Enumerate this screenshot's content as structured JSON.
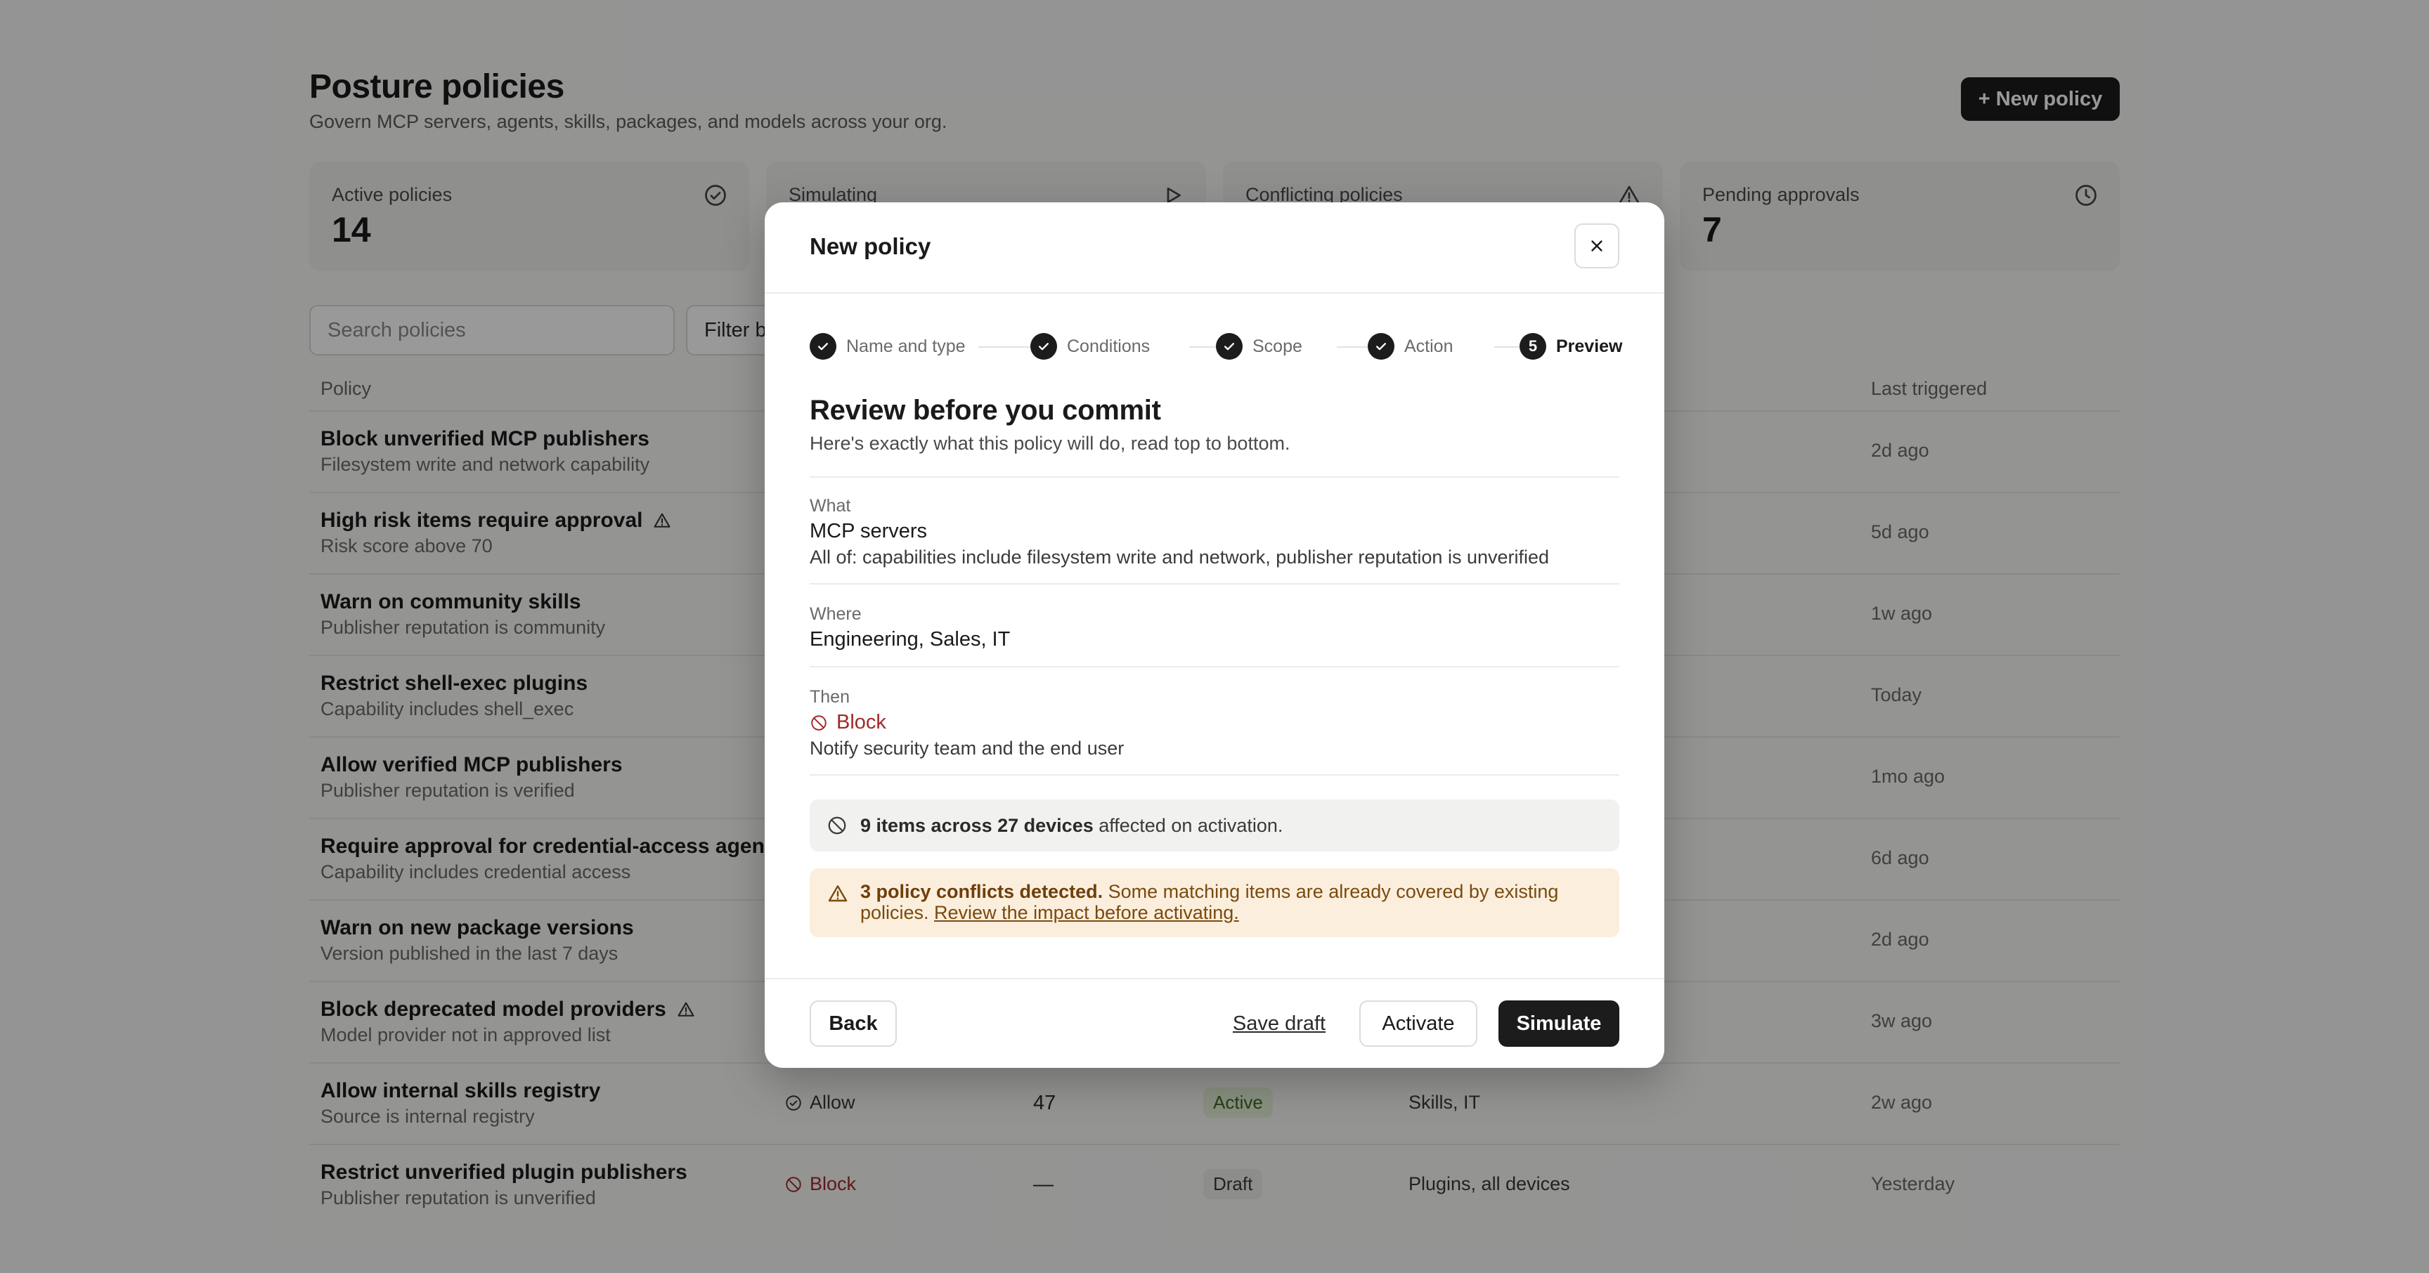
{
  "page": {
    "title": "Posture policies",
    "subtitle": "Govern MCP servers, agents, skills, packages, and models across your org.",
    "new_policy_label": "+ New policy"
  },
  "stats": [
    {
      "label": "Active policies",
      "value": "14",
      "icon": "check-circle-icon"
    },
    {
      "label": "Simulating",
      "value": "",
      "icon": "play-icon"
    },
    {
      "label": "Conflicting policies",
      "value": "",
      "icon": "warning-icon"
    },
    {
      "label": "Pending approvals",
      "value": "7",
      "icon": "clock-icon"
    }
  ],
  "toolbar": {
    "search_placeholder": "Search policies",
    "filter_label": "Filter b"
  },
  "table": {
    "columns": {
      "policy": "Policy",
      "last_triggered": "Last triggered"
    },
    "rows": [
      {
        "name": "Block unverified MCP publishers",
        "desc": "Filesystem write and network capability",
        "last": "2d ago"
      },
      {
        "name": "High risk items require approval",
        "desc": "Risk score above 70",
        "last": "5d ago",
        "warning": true
      },
      {
        "name": "Warn on community skills",
        "desc": "Publisher reputation is community",
        "last": "1w ago"
      },
      {
        "name": "Restrict shell-exec plugins",
        "desc": "Capability includes shell_exec",
        "last": "Today"
      },
      {
        "name": "Allow verified MCP publishers",
        "desc": "Publisher reputation is verified",
        "last": "1mo ago"
      },
      {
        "name": "Require approval for credential-access agents",
        "desc": "Capability includes credential access",
        "last": "6d ago"
      },
      {
        "name": "Warn on new package versions",
        "desc": "Version published in the last 7 days",
        "last": "2d ago"
      },
      {
        "name": "Block deprecated model providers",
        "desc": "Model provider not in approved list",
        "last": "3w ago",
        "warning": true
      },
      {
        "name": "Allow internal skills registry",
        "desc": "Source is internal registry",
        "last": "2w ago",
        "action": "Allow",
        "hits": "47",
        "status": "Active",
        "scope": "Skills, IT"
      },
      {
        "name": "Restrict unverified plugin publishers",
        "desc": "Publisher reputation is unverified",
        "last": "Yesterday",
        "action": "Block",
        "hits": "—",
        "status": "Draft",
        "scope": "Plugins, all devices"
      }
    ]
  },
  "modal": {
    "title": "New policy",
    "steps": [
      {
        "label": "Name and type",
        "done": true
      },
      {
        "label": "Conditions",
        "done": true
      },
      {
        "label": "Scope",
        "done": true
      },
      {
        "label": "Action",
        "done": true
      },
      {
        "label": "Preview",
        "number": "5",
        "current": true
      }
    ],
    "review_title": "Review before you commit",
    "review_subtitle": "Here's exactly what this policy will do, read top to bottom.",
    "what": {
      "label": "What",
      "value": "MCP servers",
      "detail": "All of: capabilities include filesystem write and network, publisher reputation is unverified"
    },
    "where": {
      "label": "Where",
      "value": "Engineering, Sales, IT"
    },
    "then": {
      "label": "Then",
      "action": "Block",
      "detail": "Notify security team and the end user"
    },
    "impact": {
      "bold": "9 items across 27 devices",
      "rest": " affected on activation."
    },
    "conflict": {
      "bold": "3 policy conflicts detected.",
      "text": " Some matching items are already covered by existing policies. ",
      "link": "Review the impact before activating."
    },
    "buttons": {
      "back": "Back",
      "save_draft": "Save draft",
      "activate": "Activate",
      "simulate": "Simulate"
    }
  }
}
